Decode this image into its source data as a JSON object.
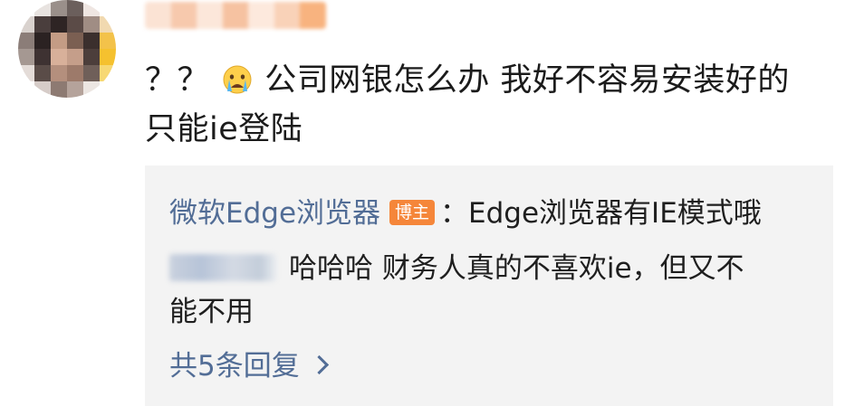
{
  "comment": {
    "text_part1": "？？",
    "emoji": "crying-face-icon",
    "text_part2": "公司网银怎么办 我好不容易安装好的只能ie登陆"
  },
  "reply": {
    "author": "微软Edge浏览器",
    "author_badge": "博主",
    "author_text": "：Edge浏览器有IE模式哦",
    "user_reply_text": "哈哈哈 财务人真的不喜欢ie，但又不",
    "user_reply_text_cont": "能不用"
  },
  "more_replies": {
    "label": "共5条回复"
  },
  "colors": {
    "link": "#526d96",
    "badge": "#f5863a",
    "reply_bg": "#f3f3f3"
  }
}
